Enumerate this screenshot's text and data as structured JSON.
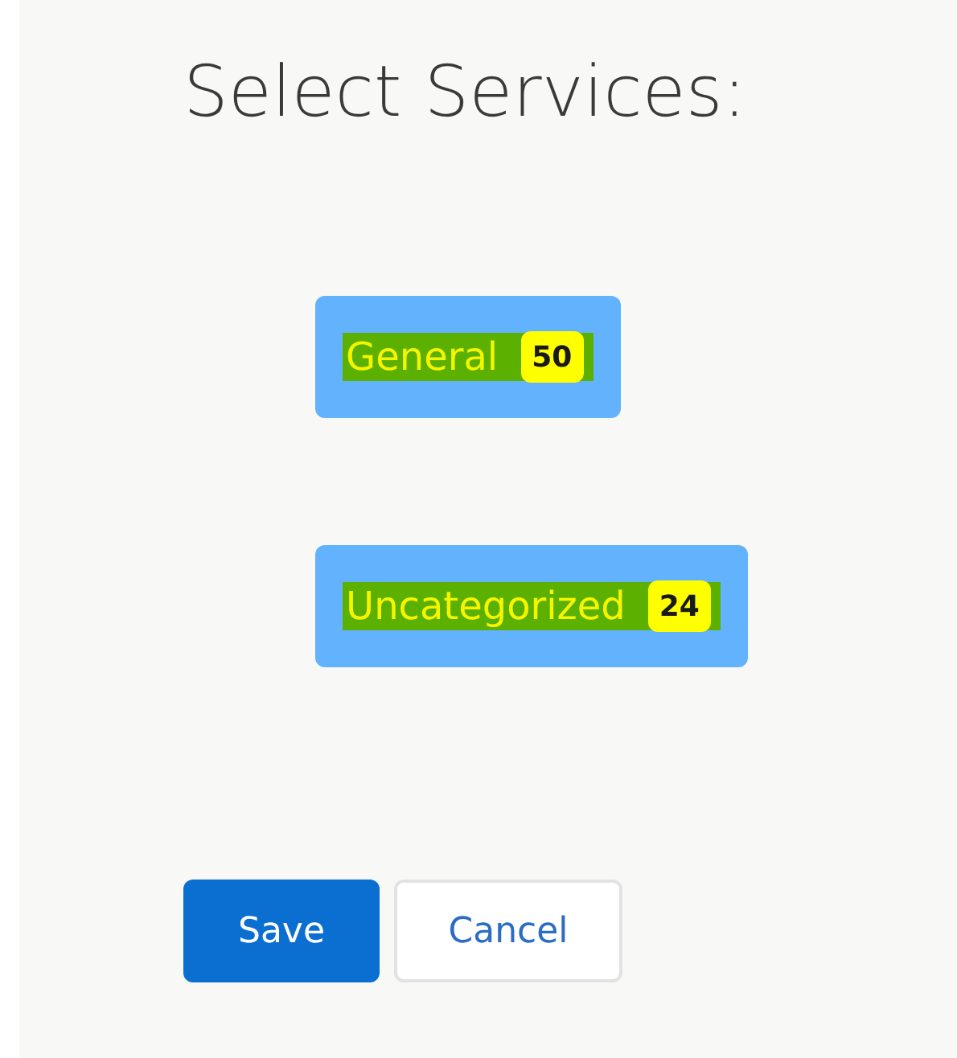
{
  "title": "Select Services:",
  "services": [
    {
      "label": "General",
      "count": "50"
    },
    {
      "label": "Uncategorized",
      "count": "24"
    }
  ],
  "buttons": [
    {
      "label": "Save",
      "kind": "primary"
    },
    {
      "label": "Cancel",
      "kind": "secondary"
    }
  ]
}
